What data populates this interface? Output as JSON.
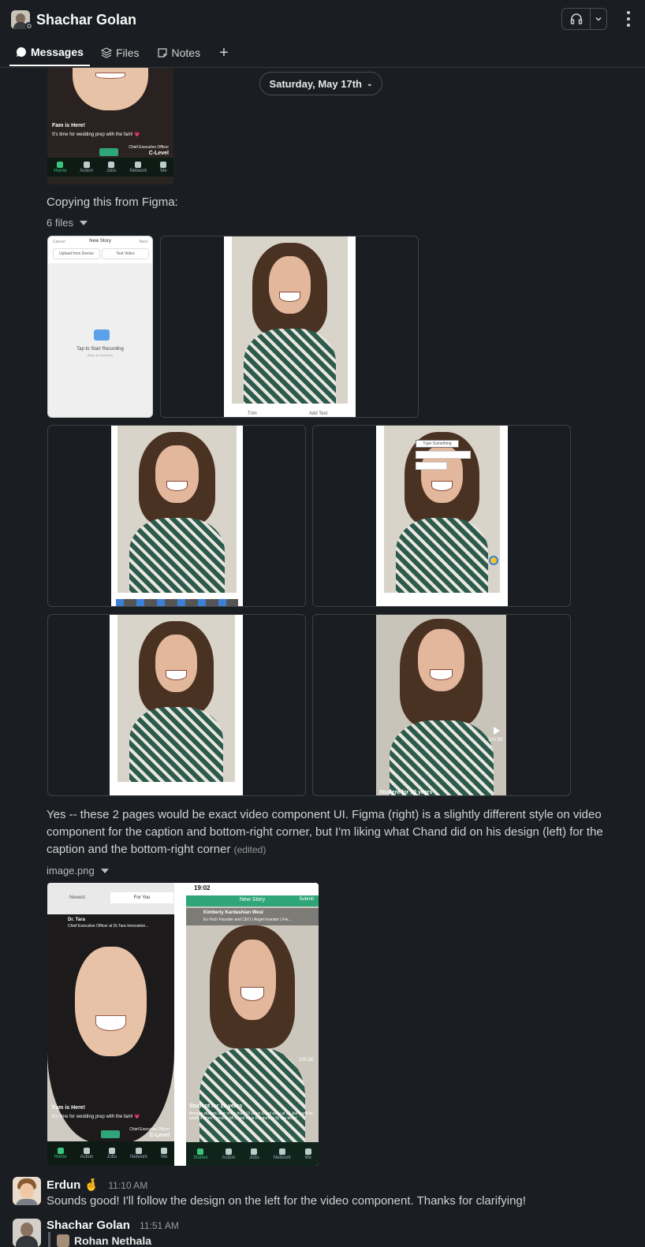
{
  "header": {
    "title": "Shachar Golan"
  },
  "tabs": [
    {
      "label": "Messages"
    },
    {
      "label": "Files"
    },
    {
      "label": "Notes"
    }
  ],
  "date_divider": "Saturday, May 17th",
  "top_image": {
    "caption_title": "Fam is Here!",
    "caption_body": "It's time for wedding prep with the fam! 💗",
    "role_line1": "Chief Executive Officer",
    "role_line2": "C-Level",
    "nav": [
      "Home",
      "Action",
      "Jobs",
      "Network",
      "Me"
    ]
  },
  "message1": {
    "text": "Copying this from Figma:",
    "files_label": "6 files"
  },
  "figma_screen": {
    "cancel": "Cancel",
    "title": "New Story",
    "next": "Next",
    "upload": "Upload from Device",
    "text_video": "Text Video",
    "record": "Tap to Start Recording",
    "record_hint": "(Max 30 seconds)"
  },
  "thumb_labels": {
    "trim": "Trim",
    "add_text": "Add Text",
    "type_something": "Type Something",
    "student": "Student for 10 years",
    "likes": "100.5K"
  },
  "message2": {
    "text": "Yes -- these 2 pages would be exact video component UI. Figma (right) is a slightly different style on video component for the caption and bottom-right corner, but I'm liking what Chand did on his design (left) for the caption and the bottom-right corner",
    "edited": "(edited)",
    "file_label": "image.png"
  },
  "compare_left": {
    "tab_newest": "Newest",
    "tab_for_you": "For You",
    "name": "Dr. Tara",
    "role": "Chief Executive Officer at Dr.Tara Innovation...",
    "caption_title": "Fam is Here!",
    "caption_body": "It's time for wedding prep with the fam! 💗",
    "role_line1": "Chief Executive Officer",
    "role_line2": "C-Level"
  },
  "compare_right": {
    "time": "19:02",
    "header_title": "New Story",
    "submit": "Submit",
    "name": "Kimberly Kardashian West",
    "role": "Ex-Tech Founder and CEO | Angel Investor | Fre...",
    "student": "Student for 10 years",
    "body": "Being a student after more than 10 years is not easy at all, but it will be worth it when I receive MIT, and have freedom to fly like birds!",
    "likes": "100.5K",
    "nav": [
      "Stories",
      "Action",
      "Jobs",
      "Network",
      "Me"
    ]
  },
  "message3": {
    "sender": "Erdun",
    "emoji": "🤞",
    "time": "11:10 AM",
    "text": "Sounds good! I'll follow the design on the left for the video component. Thanks for clarifying!"
  },
  "message4": {
    "sender": "Shachar Golan",
    "time": "11:51 AM",
    "quote_name": "Rohan Nethala"
  },
  "colors": {
    "background": "#1a1d21",
    "accent_green": "#2ea67a",
    "text": "#d1d2d3"
  }
}
